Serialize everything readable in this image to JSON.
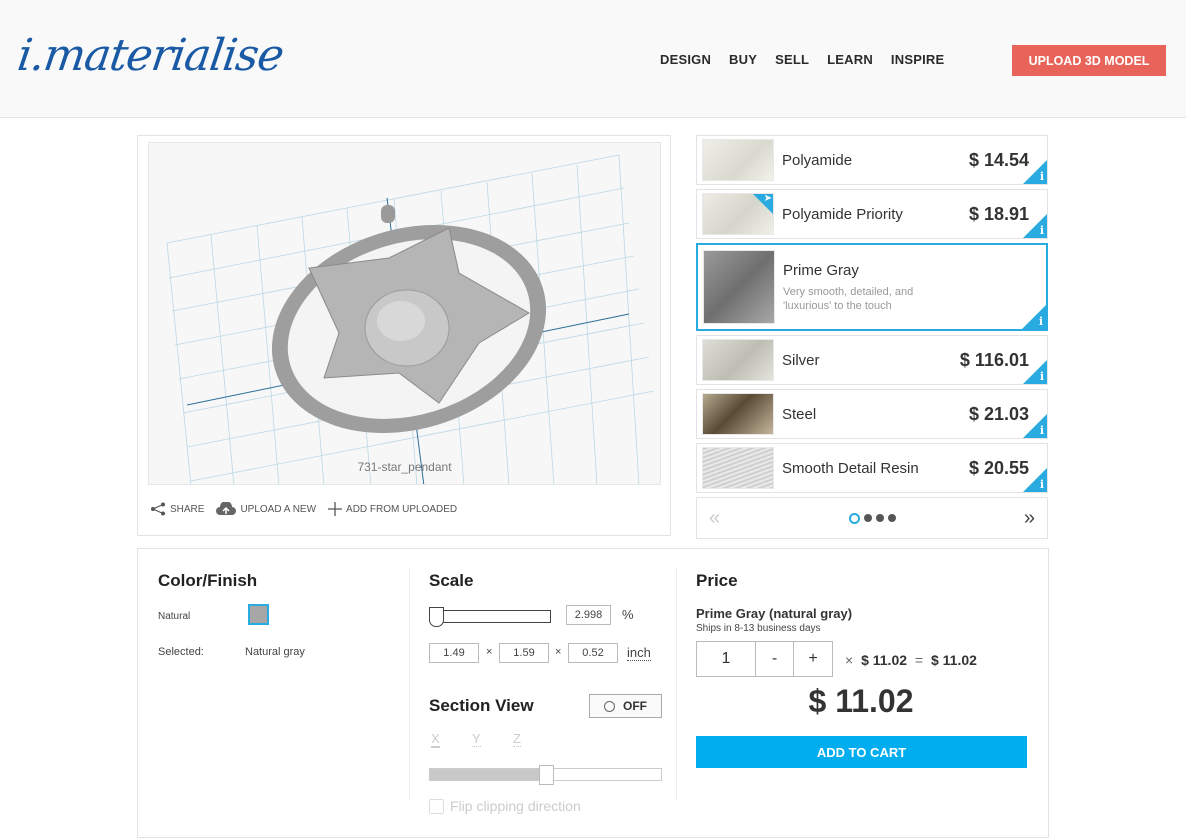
{
  "header": {
    "logo_text": "i.materialise",
    "nav": [
      "DESIGN",
      "BUY",
      "SELL",
      "LEARN",
      "INSPIRE"
    ],
    "upload_button": "UPLOAD 3D MODEL",
    "brand_color": "#1a5aa5",
    "upload_color": "#e8645a"
  },
  "viewer": {
    "model_name": "731-star_pendant",
    "actions": [
      {
        "icon": "share-icon",
        "label": "SHARE"
      },
      {
        "icon": "cloud-upload-icon",
        "label": "UPLOAD A NEW"
      },
      {
        "icon": "plus-icon",
        "label": "ADD FROM UPLOADED"
      }
    ]
  },
  "materials": {
    "items": [
      {
        "name": "Polyamide",
        "price": "$ 14.54",
        "selected": false,
        "priority": false
      },
      {
        "name": "Polyamide Priority",
        "price": "$ 18.91",
        "selected": false,
        "priority": true
      },
      {
        "name": "Prime Gray",
        "price": "",
        "selected": true,
        "priority": false,
        "description": "Very smooth, detailed, and 'luxurious' to the touch"
      },
      {
        "name": "Silver",
        "price": "$ 116.01",
        "selected": false,
        "priority": false
      },
      {
        "name": "Steel",
        "price": "$ 21.03",
        "selected": false,
        "priority": false
      },
      {
        "name": "Smooth Detail Resin",
        "price": "$ 20.55",
        "selected": false,
        "priority": false
      }
    ],
    "pager": {
      "prev": "«",
      "next": "»",
      "pages": 4,
      "current_page": 1
    },
    "accent_color": "#29abe2"
  },
  "color_finish": {
    "title": "Color/Finish",
    "option_label": "Natural",
    "swatch_color": "#a6a6a6",
    "selected_label": "Selected:",
    "selected_value": "Natural gray"
  },
  "scale": {
    "title": "Scale",
    "percent_value": "2.998",
    "percent_unit": "%",
    "slider_fraction": 0.0,
    "dims": [
      "1.49",
      "1.59",
      "0.52"
    ],
    "times": "×",
    "unit": "inch"
  },
  "section_view": {
    "title": "Section View",
    "toggle_label": "OFF",
    "axes": [
      "X",
      "Y",
      "Z"
    ],
    "active_axis": "X",
    "slider_fraction": 0.5,
    "flip_label": "Flip clipping direction"
  },
  "price": {
    "title": "Price",
    "material_line": "Prime Gray (natural gray)",
    "shipping": "Ships in 8-13 business days",
    "quantity": "1",
    "minus": "-",
    "plus": "+",
    "times": "×",
    "unit_price": "$ 11.02",
    "equals": "=",
    "line_total": "$ 11.02",
    "total": "$ 11.02",
    "add_to_cart": "ADD TO CART",
    "cart_color": "#00adee"
  }
}
